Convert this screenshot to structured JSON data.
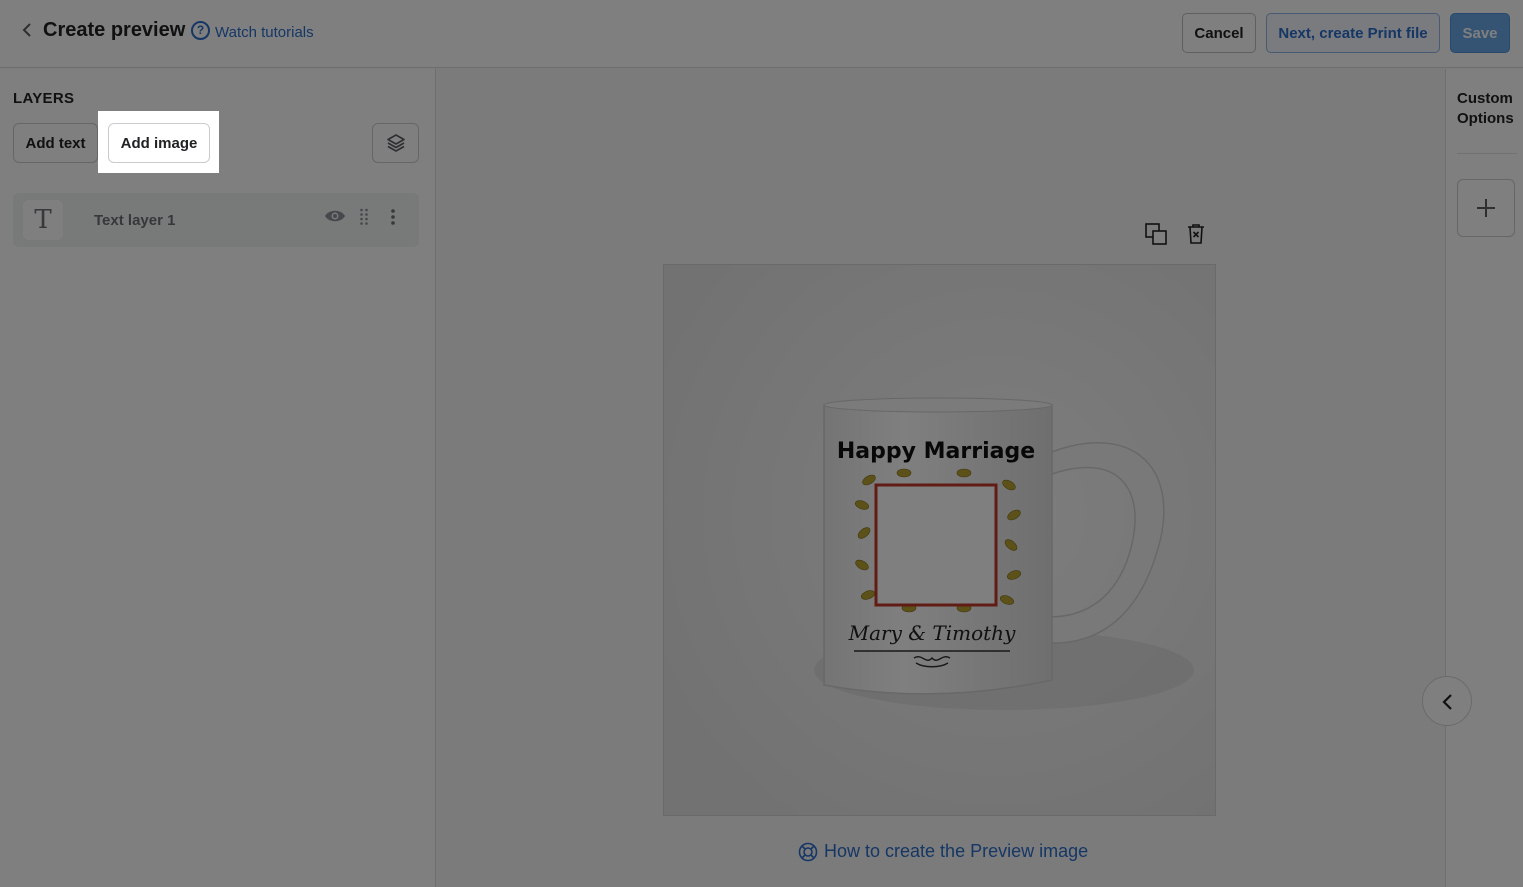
{
  "header": {
    "title": "Create preview",
    "watch_label": "Watch tutorials",
    "cancel_label": "Cancel",
    "next_label": "Next, create Print file",
    "save_label": "Save"
  },
  "layers": {
    "title": "LAYERS",
    "add_text_label": "Add text",
    "add_image_label": "Add image",
    "items": [
      {
        "label": "Text layer 1",
        "icon": "T"
      }
    ]
  },
  "preview": {
    "mug_title": "Happy Marriage",
    "mug_names": "Mary & Timothy",
    "howto_label": "How to create the Preview image"
  },
  "right": {
    "custom_options_label": "Custom Options"
  },
  "colors": {
    "accent": "#2c6ecb",
    "save_bg": "#6ba9e8",
    "overlay": "rgba(0,0,0,0.5)"
  }
}
